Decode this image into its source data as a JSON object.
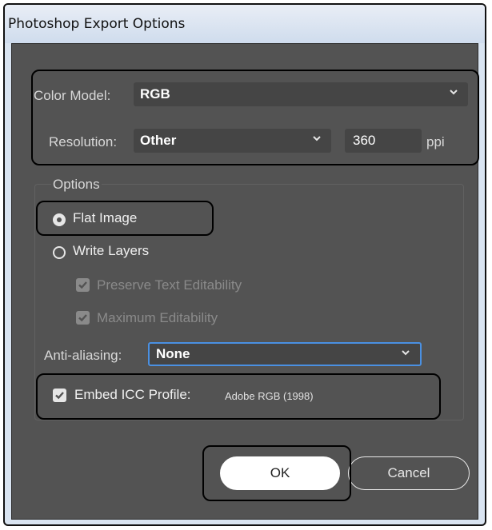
{
  "window": {
    "title": "Photoshop Export Options"
  },
  "color_model": {
    "label": "Color Model:",
    "value": "RGB"
  },
  "resolution": {
    "label": "Resolution:",
    "value": "Other",
    "ppi_value": "360",
    "unit": "ppi"
  },
  "options": {
    "group_label": "Options",
    "flat_image_label": "Flat Image",
    "flat_image_selected": true,
    "write_layers_label": "Write Layers",
    "write_layers_selected": false,
    "preserve_text_label": "Preserve Text Editability",
    "preserve_text_checked": true,
    "max_editability_label": "Maximum Editability",
    "max_editability_checked": true,
    "anti_aliasing_label": "Anti-aliasing:",
    "anti_aliasing_value": "None",
    "embed_icc_label": "Embed ICC Profile:",
    "embed_icc_checked": true,
    "embed_icc_profile": "Adobe RGB (1998)"
  },
  "buttons": {
    "ok_label": "OK",
    "cancel_label": "Cancel"
  },
  "colors": {
    "panel_bg": "#535353",
    "field_bg": "#454545",
    "focus_border": "#4a90e2",
    "titlebar": "#d9e4f1"
  }
}
